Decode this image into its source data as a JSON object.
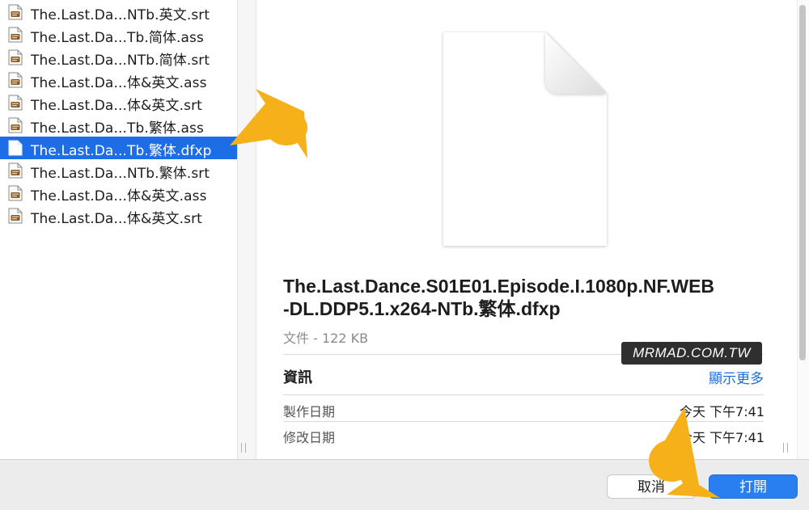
{
  "files": [
    {
      "name": "The.Last.Da...NTb.英文.srt",
      "icon": "subtitle-file-icon",
      "selected": false
    },
    {
      "name": "The.Last.Da...Tb.简体.ass",
      "icon": "subtitle-file-icon",
      "selected": false
    },
    {
      "name": "The.Last.Da...NTb.简体.srt",
      "icon": "subtitle-file-icon",
      "selected": false
    },
    {
      "name": "The.Last.Da...体&英文.ass",
      "icon": "subtitle-file-icon",
      "selected": false
    },
    {
      "name": "The.Last.Da...体&英文.srt",
      "icon": "subtitle-file-icon",
      "selected": false
    },
    {
      "name": "The.Last.Da...Tb.繁体.ass",
      "icon": "subtitle-file-icon",
      "selected": false
    },
    {
      "name": "The.Last.Da...Tb.繁体.dfxp",
      "icon": "blank-document-icon",
      "selected": true
    },
    {
      "name": "The.Last.Da...NTb.繁体.srt",
      "icon": "subtitle-file-icon",
      "selected": false
    },
    {
      "name": "The.Last.Da...体&英文.ass",
      "icon": "subtitle-file-icon",
      "selected": false
    },
    {
      "name": "The.Last.Da...体&英文.srt",
      "icon": "subtitle-file-icon",
      "selected": false
    }
  ],
  "preview": {
    "title_line1": "The.Last.Dance.S01E01.Episode.I.1080p.NF.WEB",
    "title_line2": "-DL.DDP5.1.x264-NTb.繁体.dfxp",
    "kind": "文件 - 122 KB",
    "info_heading": "資訊",
    "show_more": "顯示更多",
    "created_label": "製作日期",
    "created_value": "今天 下午7:41",
    "modified_label": "修改日期",
    "modified_value": "今天 下午7:41"
  },
  "watermark": "MRMAD.COM.TW",
  "buttons": {
    "cancel": "取消",
    "open": "打開"
  },
  "colors": {
    "selection": "#1d6ee6",
    "accent": "#2a7ff0",
    "arrow": "#f5b01a"
  }
}
